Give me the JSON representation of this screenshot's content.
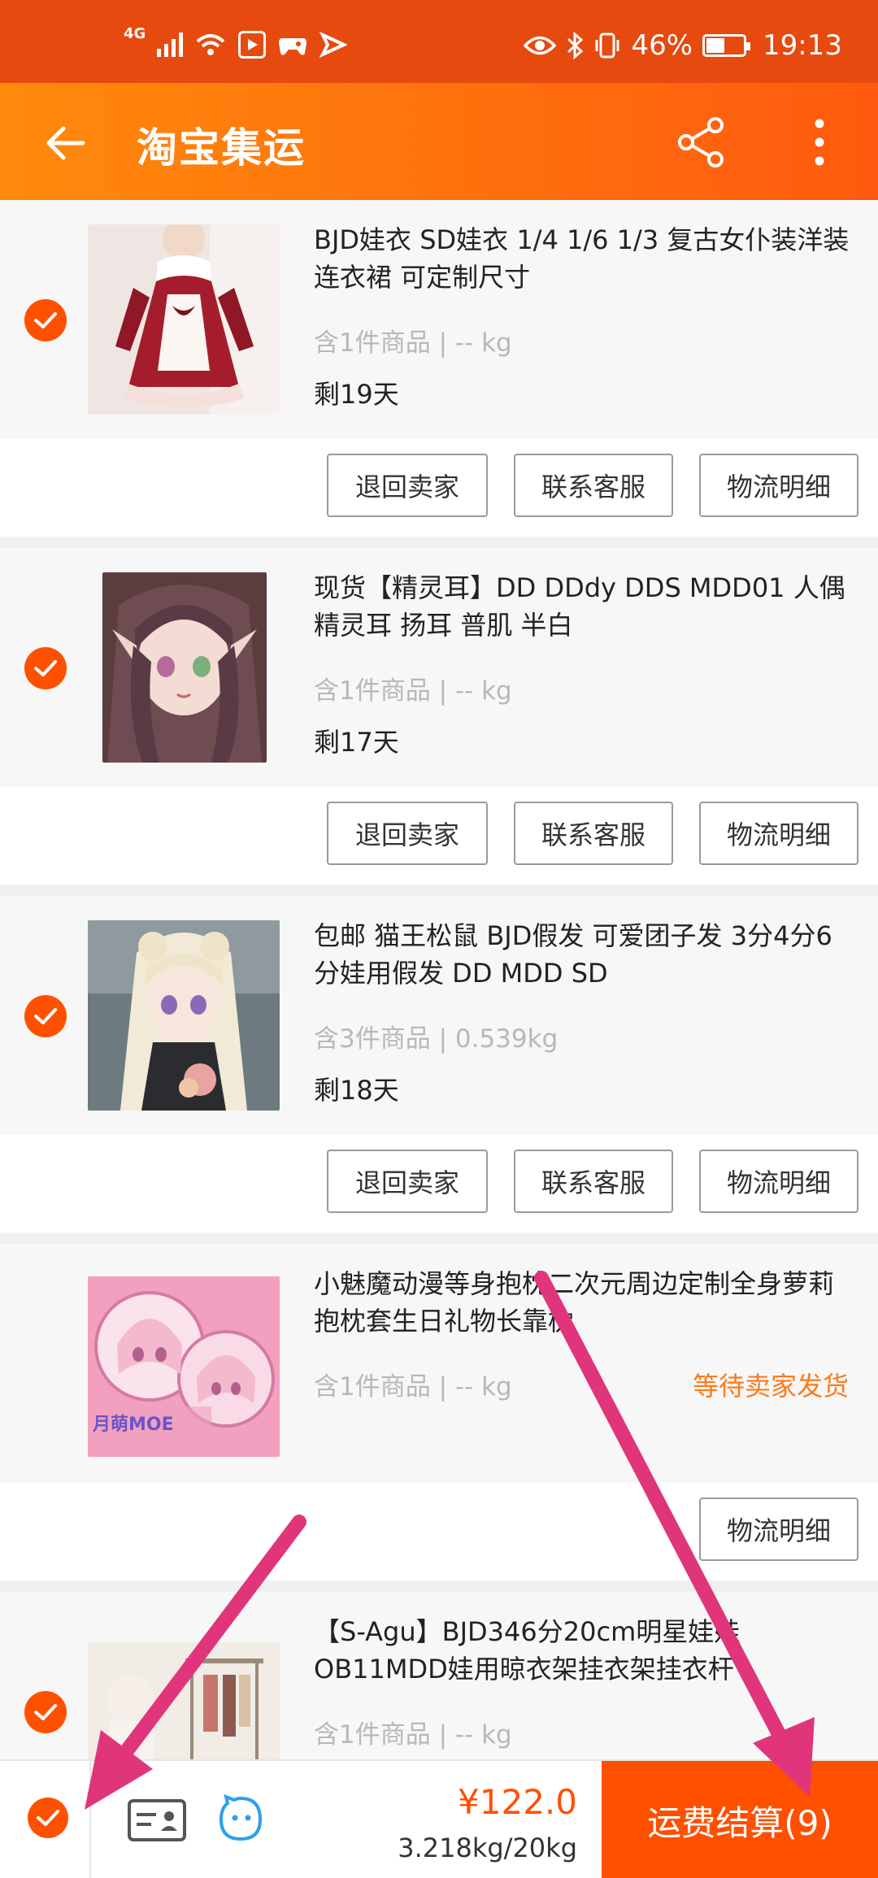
{
  "status_bar": {
    "network": "4G",
    "battery_text": "46%",
    "battery_level": 0.46,
    "time": "19:13"
  },
  "header": {
    "title": "淘宝集运",
    "icons": [
      "back-arrow-icon",
      "share-icon",
      "more-icon"
    ]
  },
  "orders": [
    {
      "title": "BJD娃衣 SD娃衣 1/4 1/6 1/3 复古女仆装洋装 连衣裙 可定制尺寸",
      "meta": "含1件商品 | -- kg",
      "days_left": "剩19天",
      "checked": true,
      "status": "",
      "buttons": [
        "退回卖家",
        "联系客服",
        "物流明细"
      ]
    },
    {
      "title": "现货【精灵耳】DD DDdy DDS MDD01 人偶精灵耳 扬耳 普肌 半白",
      "meta": "含1件商品 | -- kg",
      "days_left": "剩17天",
      "checked": true,
      "status": "",
      "buttons": [
        "退回卖家",
        "联系客服",
        "物流明细"
      ]
    },
    {
      "title": "包邮 猫王松鼠 BJD假发 可爱团子发 3分4分6分娃用假发 DD MDD SD",
      "meta": "含3件商品 | 0.539kg",
      "days_left": "剩18天",
      "checked": true,
      "status": "",
      "buttons": [
        "退回卖家",
        "联系客服",
        "物流明细"
      ]
    },
    {
      "title": "小魅魔动漫等身抱枕二次元周边定制全身萝莉抱枕套生日礼物长靠枕",
      "meta": "含1件商品 | -- kg",
      "days_left": "",
      "checked": false,
      "status": "等待卖家发货",
      "buttons": [
        "物流明细"
      ]
    },
    {
      "title": "【S-Agu】BJD346分20cm明星娃娃OB11MDD娃用晾衣架挂衣架挂衣杆",
      "meta": "含1件商品 | -- kg",
      "days_left": "",
      "checked": true,
      "status": "",
      "buttons": []
    }
  ],
  "thumb_texts": {
    "order4_logo": "月萌MOE"
  },
  "footer": {
    "price": "¥122.0",
    "weight": "3.218kg/20kg",
    "settle_label": "运费结算(9)"
  },
  "colors": {
    "accent": "#ff5000",
    "status_bar": "#e64a0f",
    "nav_gradient_start": "#ff8a0c",
    "nav_gradient_end": "#ff5a0e",
    "status_text": "#ff7a1a",
    "annotation_arrow": "#e0357a"
  }
}
